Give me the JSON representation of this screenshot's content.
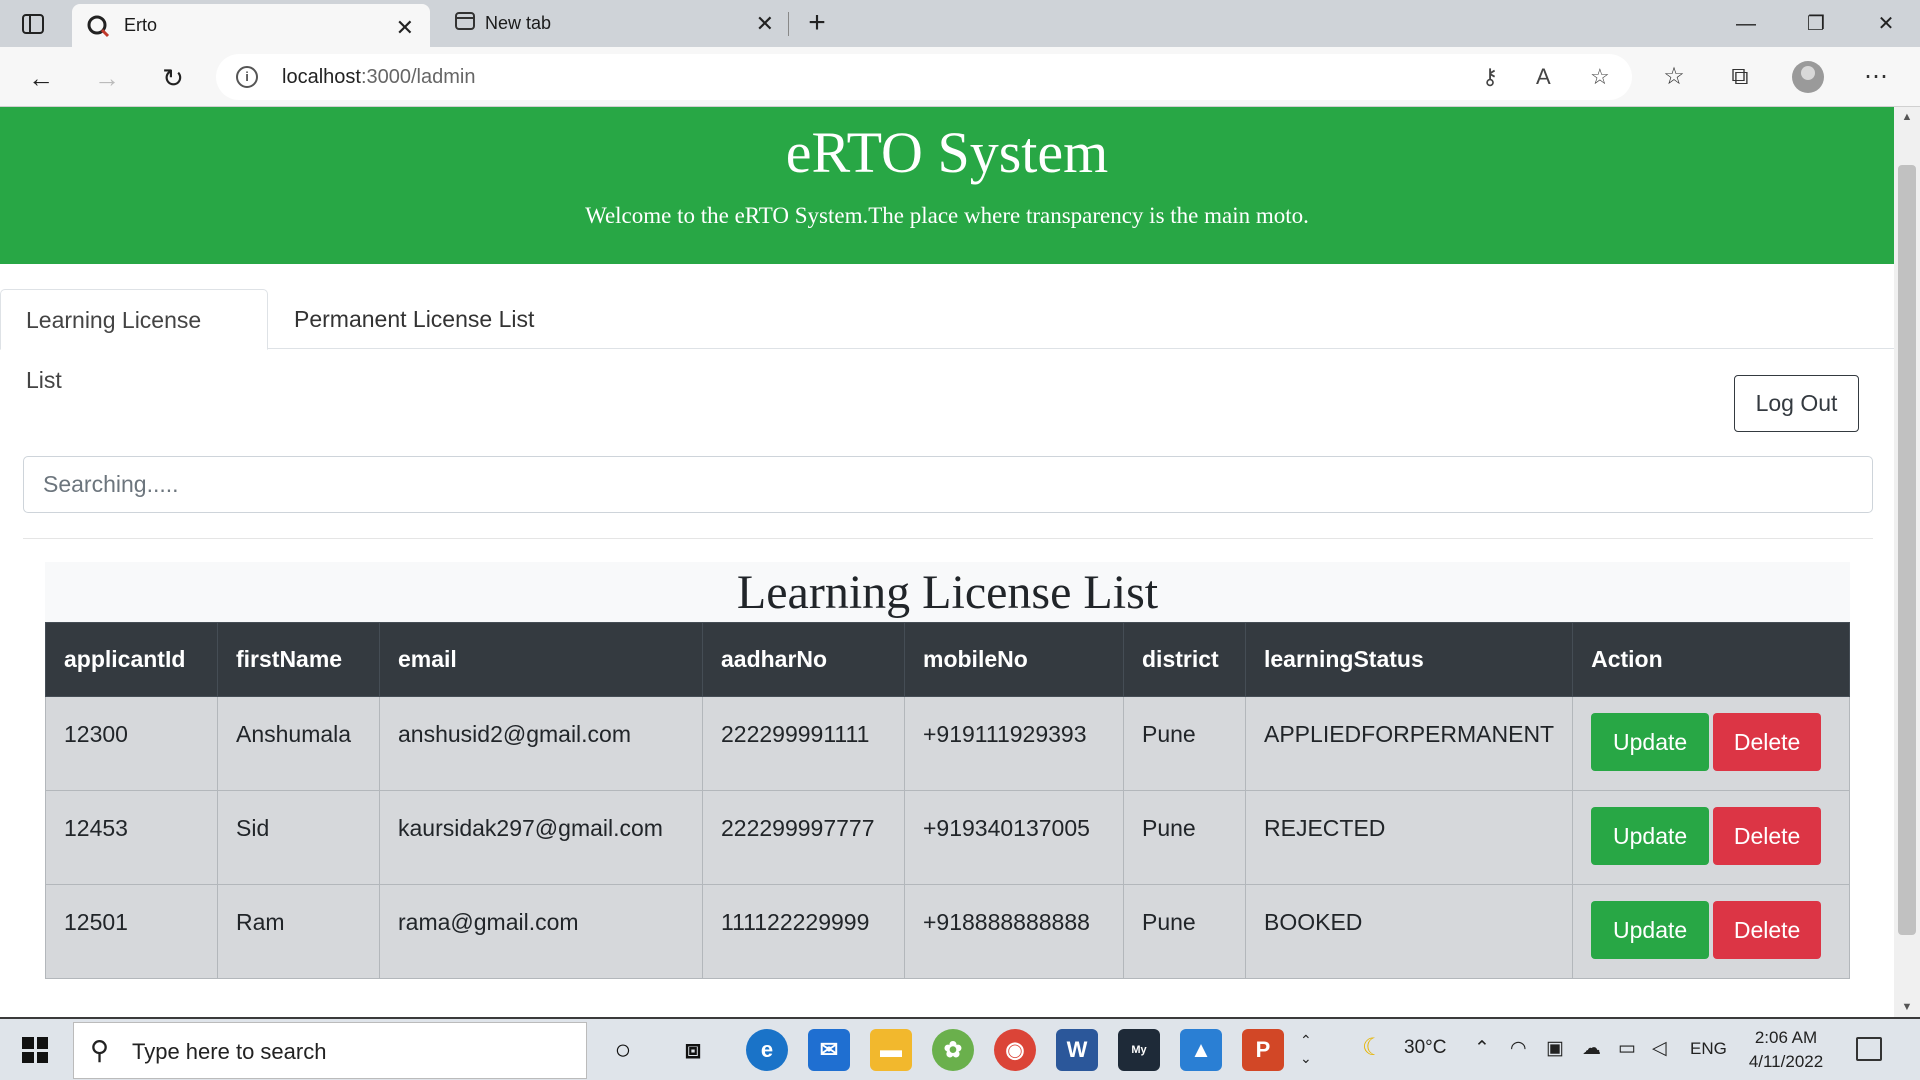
{
  "browser": {
    "tabs": [
      {
        "title": "Erto",
        "active": true
      },
      {
        "title": "New tab",
        "active": false
      }
    ],
    "url_host": "localhost",
    "url_path": ":3000/ladmin"
  },
  "header": {
    "title": "eRTO System",
    "subtitle": "Welcome to the eRTO System.The place where transparency is the main moto."
  },
  "nav_tabs": [
    "Learning License List",
    "Permanent License List"
  ],
  "logout_label": "Log Out",
  "search": {
    "placeholder": "Searching....."
  },
  "list_title": "Learning License List",
  "table": {
    "columns": [
      "applicantId",
      "firstName",
      "email",
      "aadharNo",
      "mobileNo",
      "district",
      "learningStatus",
      "Action"
    ],
    "rows": [
      [
        "12300",
        "Anshumala",
        "anshusid2@gmail.com",
        "222299991111",
        "+919111929393",
        "Pune",
        "APPLIEDFORPERMANENT"
      ],
      [
        "12453",
        "Sid",
        "kaursidak297@gmail.com",
        "222299997777",
        "+919340137005",
        "Pune",
        "REJECTED"
      ],
      [
        "12501",
        "Ram",
        "rama@gmail.com",
        "111122229999",
        "+918888888888",
        "Pune",
        "BOOKED"
      ]
    ],
    "update_label": "Update",
    "delete_label": "Delete"
  },
  "taskbar": {
    "search_placeholder": "Type here to search",
    "temperature": "30°C",
    "language": "ENG",
    "time": "2:06 AM",
    "date": "4/11/2022"
  },
  "colors": {
    "hero": "#28a745",
    "table_header": "#343a40",
    "update": "#28a745",
    "delete": "#dc3545"
  }
}
